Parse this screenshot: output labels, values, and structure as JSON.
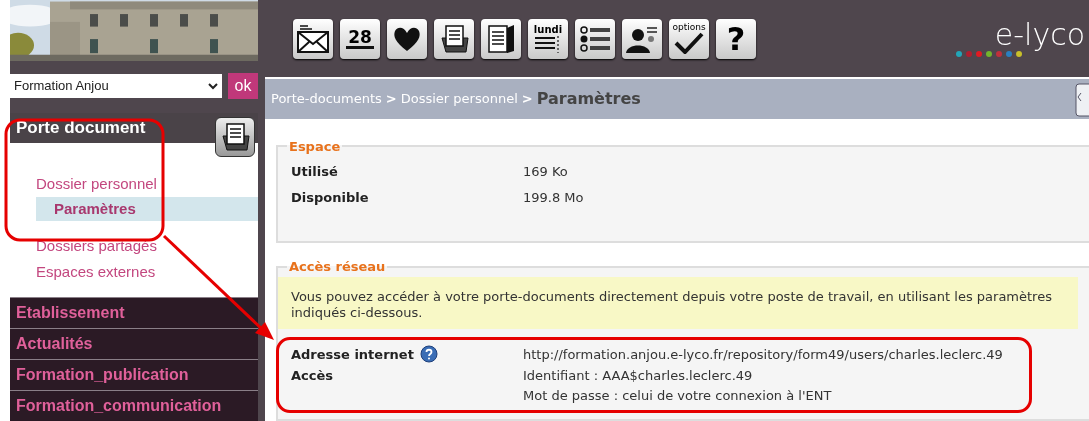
{
  "sidebar": {
    "establishment_select": {
      "value": "Formation Anjou"
    },
    "ok_button": "ok",
    "section": {
      "title": "Porte document",
      "items": [
        {
          "label": "Dossier personnel",
          "selected": false,
          "children": [
            {
              "label": "Paramètres",
              "selected": true
            }
          ]
        },
        {
          "label": "Dossiers partagés",
          "selected": false
        },
        {
          "label": "Espaces externes",
          "selected": false
        }
      ]
    },
    "menu": [
      "Etablissement",
      "Actualités",
      "Formation_publication",
      "Formation_communication"
    ]
  },
  "toolbar": [
    {
      "kind": "mail"
    },
    {
      "kind": "calendar",
      "label": "28"
    },
    {
      "kind": "heart"
    },
    {
      "kind": "inbox"
    },
    {
      "kind": "notebook"
    },
    {
      "kind": "agenda",
      "label": "lundi"
    },
    {
      "kind": "list"
    },
    {
      "kind": "contacts"
    },
    {
      "kind": "options",
      "label": "options"
    },
    {
      "kind": "help",
      "label": "?"
    }
  ],
  "logo": "e-lyco",
  "breadcrumb": {
    "separator": ">",
    "items": [
      "Porte-documents",
      "Dossier personnel",
      "Paramètres"
    ]
  },
  "espace": {
    "legend": "Espace",
    "rows": [
      {
        "label": "Utilisé",
        "values": [
          "169 Ko"
        ],
        "help": false
      },
      {
        "label": "Disponible",
        "values": [
          "199.8 Mo"
        ],
        "help": false
      }
    ]
  },
  "acces_reseau": {
    "legend": "Accès réseau",
    "notice": "Vous pouvez accéder à votre porte-documents directement depuis votre poste de travail, en utilisant les paramètres indiqués ci-dessous.",
    "rows": [
      {
        "label": "Adresse internet",
        "values": [
          "http://formation.anjou.e-lyco.fr/repository/form49/users/charles.leclerc.49"
        ],
        "help": true
      },
      {
        "label": "Accès",
        "values": [
          "Identifiant : AAA$charles.leclerc.49",
          "Mot de passe : celui de votre connexion à l'ENT"
        ],
        "help": false
      }
    ]
  }
}
